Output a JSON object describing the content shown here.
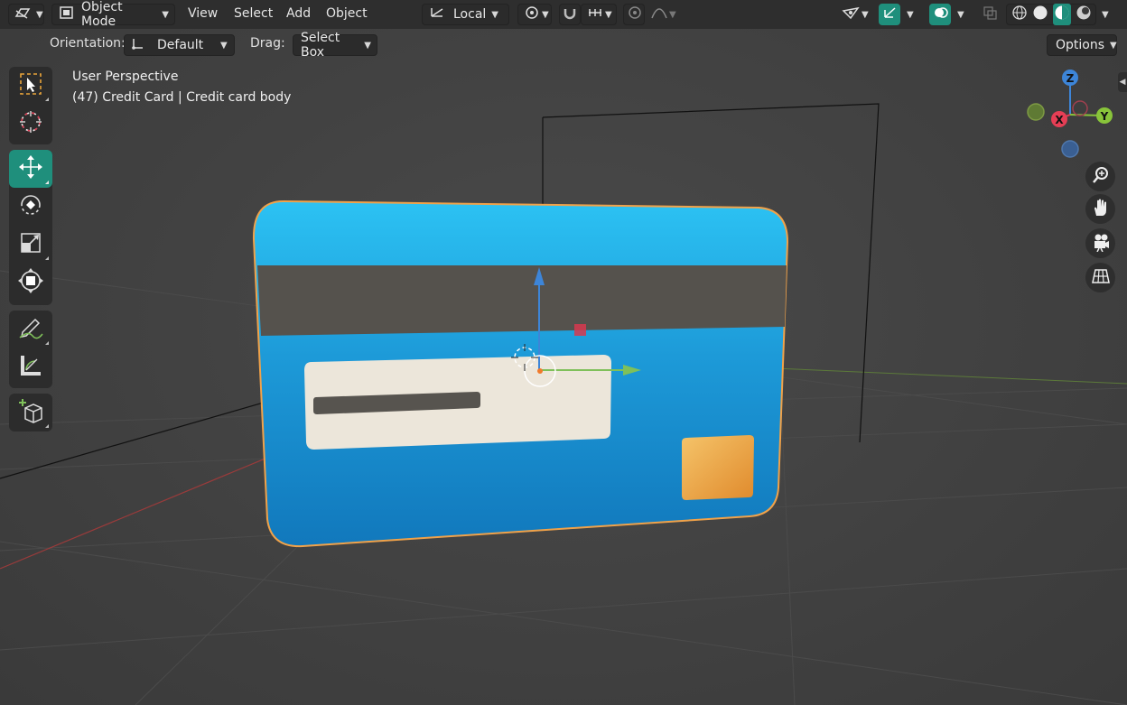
{
  "header": {
    "mode_label": "Object Mode",
    "menus": [
      "View",
      "Select",
      "Add",
      "Object"
    ],
    "transform_orientation": "Local",
    "options_label": "Options"
  },
  "tool_header": {
    "orientation_label": "Orientation:",
    "orientation_value": "Default",
    "drag_label": "Drag:",
    "drag_value": "Select Box"
  },
  "viewport": {
    "view_name": "User Perspective",
    "object_info": "(47) Credit Card | Credit card body"
  },
  "gizmo": {
    "z_label": "Z",
    "x_label": "X",
    "y_label": "Y"
  },
  "icons": {
    "editor_type": "3d-viewport-icon",
    "mode": "object-mode-icon",
    "orientation": "transform-orientation-icon",
    "pivot": "pivot-point-icon",
    "snap": "snap-magnet-icon",
    "snap_increment": "snap-increment-icon",
    "proportional": "proportional-editing-icon",
    "falloff": "falloff-curve-icon",
    "visibility": "object-visibility-icon",
    "gizmo": "gizmo-toggle-icon",
    "overlays": "overlays-toggle-icon",
    "xray": "xray-toggle-icon",
    "shading": [
      "wireframe-shading-icon",
      "solid-shading-icon",
      "material-preview-icon",
      "rendered-shading-icon"
    ],
    "tools": [
      "select-box-icon",
      "cursor-icon",
      "move-icon",
      "rotate-icon",
      "scale-icon",
      "transform-icon",
      "annotate-icon",
      "measure-icon",
      "add-cube-icon"
    ],
    "nav": [
      "zoom-icon",
      "pan-hand-icon",
      "camera-view-icon",
      "ortho-grid-icon"
    ]
  },
  "colors": {
    "accent": "#1f8f7c",
    "axis_x": "#e63e55",
    "axis_y": "#88c43a",
    "axis_z": "#3d85d8",
    "card_blue": "#1e9ad8",
    "stripe": "#55524d",
    "chip": "#e8a546",
    "selection_outline": "#f0a24a"
  }
}
